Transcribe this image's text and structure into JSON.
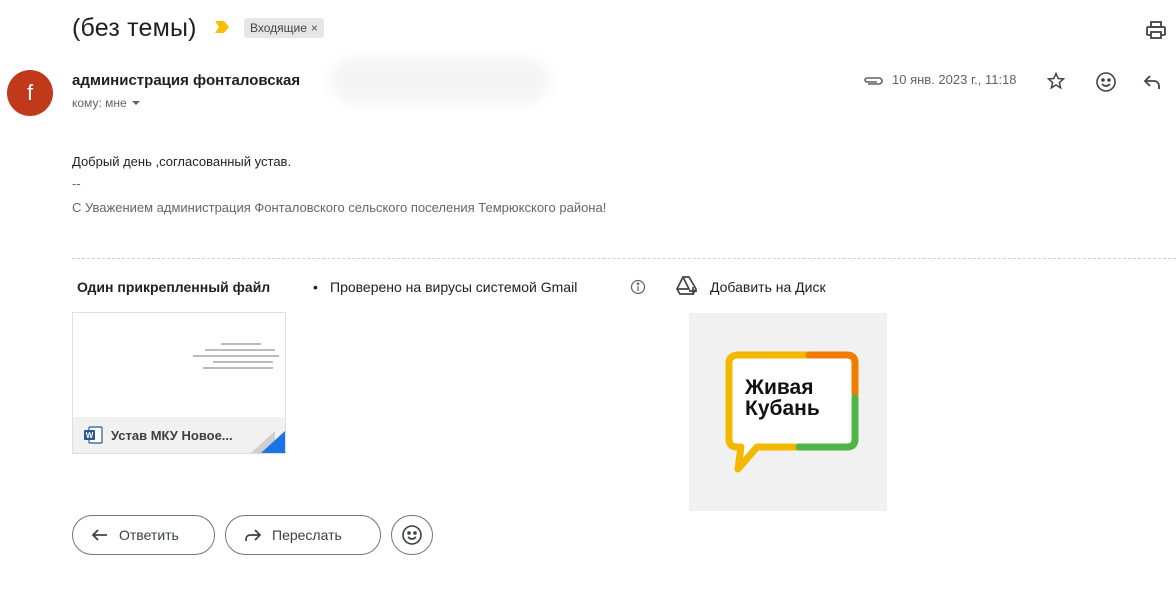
{
  "header": {
    "subject": "(без темы)",
    "label": "Входящие",
    "label_close": "×",
    "importance_icon": "importance-marker-icon",
    "print_icon": "printer-icon"
  },
  "sender": {
    "avatar_letter": "f",
    "avatar_color": "#c0391b",
    "name": "администрация фонталовская",
    "to": "кому: мне",
    "date": "10 янв. 2023 г., 11:18"
  },
  "message": {
    "line1": "Добрый день ,согласованный устав.",
    "dash": "--",
    "signature": "С Уважением администрация Фонталовского сельского поселения Темрюкского района!"
  },
  "attachments": {
    "title": "Один прикрепленный файл",
    "separator": "•",
    "scan_text": "Проверено на вирусы системой Gmail",
    "add_to_drive": "Добавить на Диск",
    "file_name": "Устав МКУ Новое...",
    "logo_line1": "Живая",
    "logo_line2": "Кубань"
  },
  "actions": {
    "reply": "Ответить",
    "forward": "Переслать"
  },
  "colors": {
    "accent": "#1a73e8",
    "logo_yellow": "#f5b800",
    "logo_orange": "#f07c00",
    "logo_green": "#4cb748"
  }
}
